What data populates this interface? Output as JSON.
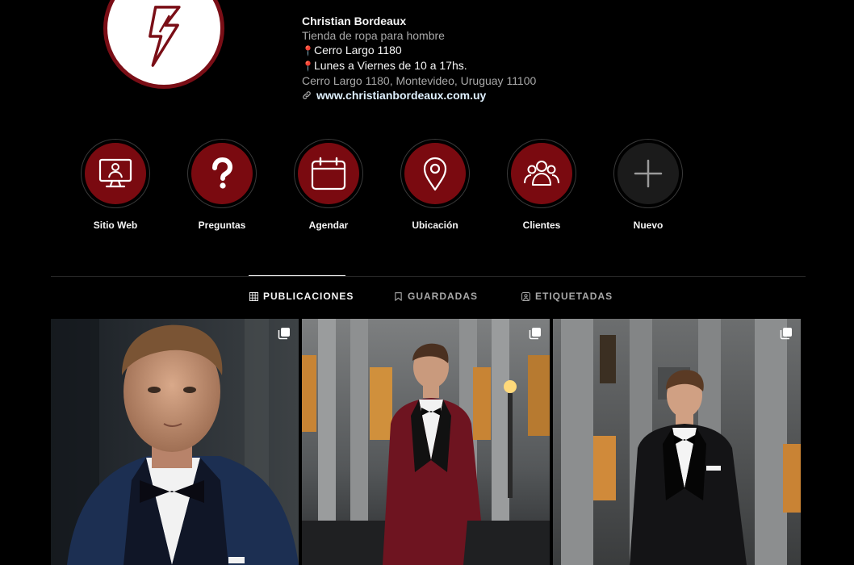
{
  "profile": {
    "name": "Christian Bordeaux",
    "category": "Tienda de ropa para hombre",
    "address_line": "Cerro Largo 1180",
    "hours_line": "Lunes a Viernes de 10 a 17hs.",
    "full_address": "Cerro Largo 1180, Montevideo, Uruguay 11100",
    "website": "www.christianbordeaux.com.uy",
    "pin_glyph": "📍"
  },
  "highlights": [
    {
      "label": "Sitio Web",
      "icon": "computer-user-icon"
    },
    {
      "label": "Preguntas",
      "icon": "question-mark-icon"
    },
    {
      "label": "Agendar",
      "icon": "calendar-icon"
    },
    {
      "label": "Ubicación",
      "icon": "location-pin-icon"
    },
    {
      "label": "Clientes",
      "icon": "group-icon"
    },
    {
      "label": "Nuevo",
      "icon": "plus-icon"
    }
  ],
  "tabs": {
    "posts": "PUBLICACIONES",
    "saved": "GUARDADAS",
    "tagged": "ETIQUETADAS"
  },
  "posts": [
    {
      "subject": "man in navy tuxedo with bow tie",
      "multi": true
    },
    {
      "subject": "man in burgundy tuxedo walking",
      "multi": true
    },
    {
      "subject": "man in black tuxedo in front of building",
      "multi": true
    }
  ],
  "colors": {
    "brand": "#7a0a10",
    "background": "#000000",
    "muted_text": "#a8a8a8",
    "link": "#e0f1ff"
  }
}
